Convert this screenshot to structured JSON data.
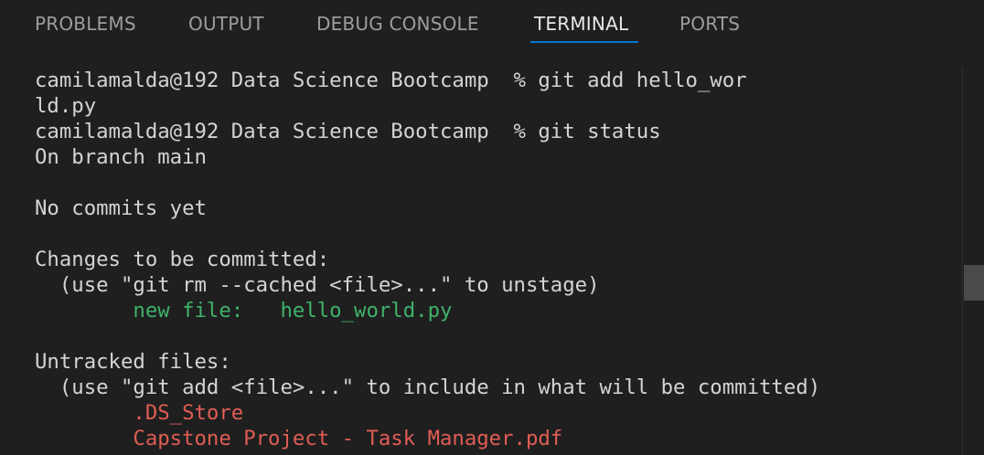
{
  "panel": {
    "tabs": [
      {
        "label": "PROBLEMS"
      },
      {
        "label": "OUTPUT"
      },
      {
        "label": "DEBUG CONSOLE"
      },
      {
        "label": "TERMINAL",
        "active": true
      },
      {
        "label": "PORTS"
      }
    ],
    "accent_color": "#0078d4"
  },
  "terminal": {
    "lines": [
      "camilamalda@192 Data Science Bootcamp  % git add hello_wor",
      "ld.py",
      "camilamalda@192 Data Science Bootcamp  % git status",
      "On branch main",
      "",
      "No commits yet",
      "",
      "Changes to be committed:",
      "  (use \"git rm --cached <file>...\" to unstage)",
      "        new file:   hello_world.py",
      "",
      "Untracked files:",
      "  (use \"git add <file>...\" to include in what will be committed)",
      "        .DS_Store",
      "        Capstone Project - Task Manager.pdf"
    ],
    "colors": {
      "staged": "#3fb26a",
      "untracked": "#e05d55"
    }
  }
}
